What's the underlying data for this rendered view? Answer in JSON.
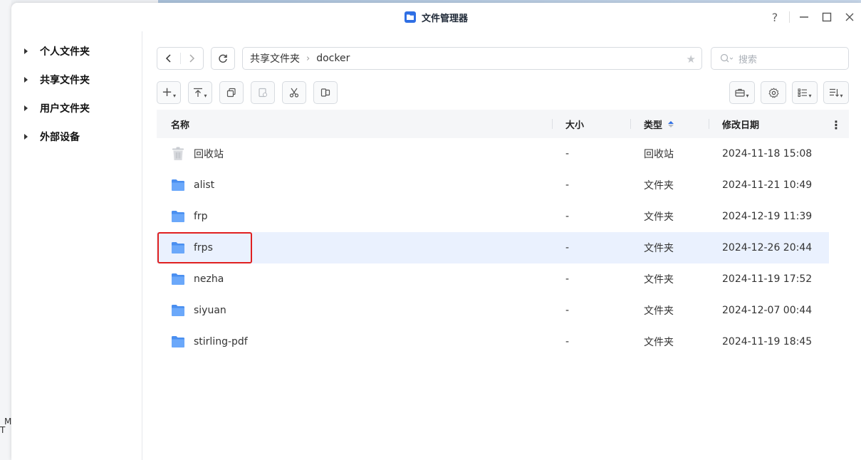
{
  "desktop": {
    "corner_text_1": "M",
    "corner_text_2": "T"
  },
  "window": {
    "title": "文件管理器",
    "controls": {
      "help": "?",
      "minimize": "—",
      "maximize": "☐",
      "close": "✕"
    }
  },
  "sidebar": {
    "items": [
      {
        "label": "个人文件夹"
      },
      {
        "label": "共享文件夹"
      },
      {
        "label": "用户文件夹"
      },
      {
        "label": "外部设备"
      }
    ]
  },
  "nav": {
    "path": [
      "共享文件夹",
      "docker"
    ],
    "path_separator": "›",
    "search_placeholder": "搜索"
  },
  "table": {
    "columns": {
      "name": "名称",
      "size": "大小",
      "type": "类型",
      "modified": "修改日期"
    },
    "sort_column": "类型",
    "rows": [
      {
        "name": "回收站",
        "size": "-",
        "type": "回收站",
        "modified": "2024-11-18 15:08",
        "icon": "trash-icon"
      },
      {
        "name": "alist",
        "size": "-",
        "type": "文件夹",
        "modified": "2024-11-21 10:49",
        "icon": "folder-icon"
      },
      {
        "name": "frp",
        "size": "-",
        "type": "文件夹",
        "modified": "2024-12-19 11:39",
        "icon": "folder-icon"
      },
      {
        "name": "frps",
        "size": "-",
        "type": "文件夹",
        "modified": "2024-12-26 20:44",
        "icon": "folder-icon",
        "selected": true
      },
      {
        "name": "nezha",
        "size": "-",
        "type": "文件夹",
        "modified": "2024-11-19 17:52",
        "icon": "folder-icon"
      },
      {
        "name": "siyuan",
        "size": "-",
        "type": "文件夹",
        "modified": "2024-12-07 00:44",
        "icon": "folder-icon"
      },
      {
        "name": "stirling-pdf",
        "size": "-",
        "type": "文件夹",
        "modified": "2024-11-19 18:45",
        "icon": "folder-icon"
      }
    ]
  },
  "colors": {
    "accent": "#2f6fe4",
    "folder": "#5b9cf5",
    "selected_row": "#eaf1fe",
    "highlight_box": "#e02020"
  }
}
